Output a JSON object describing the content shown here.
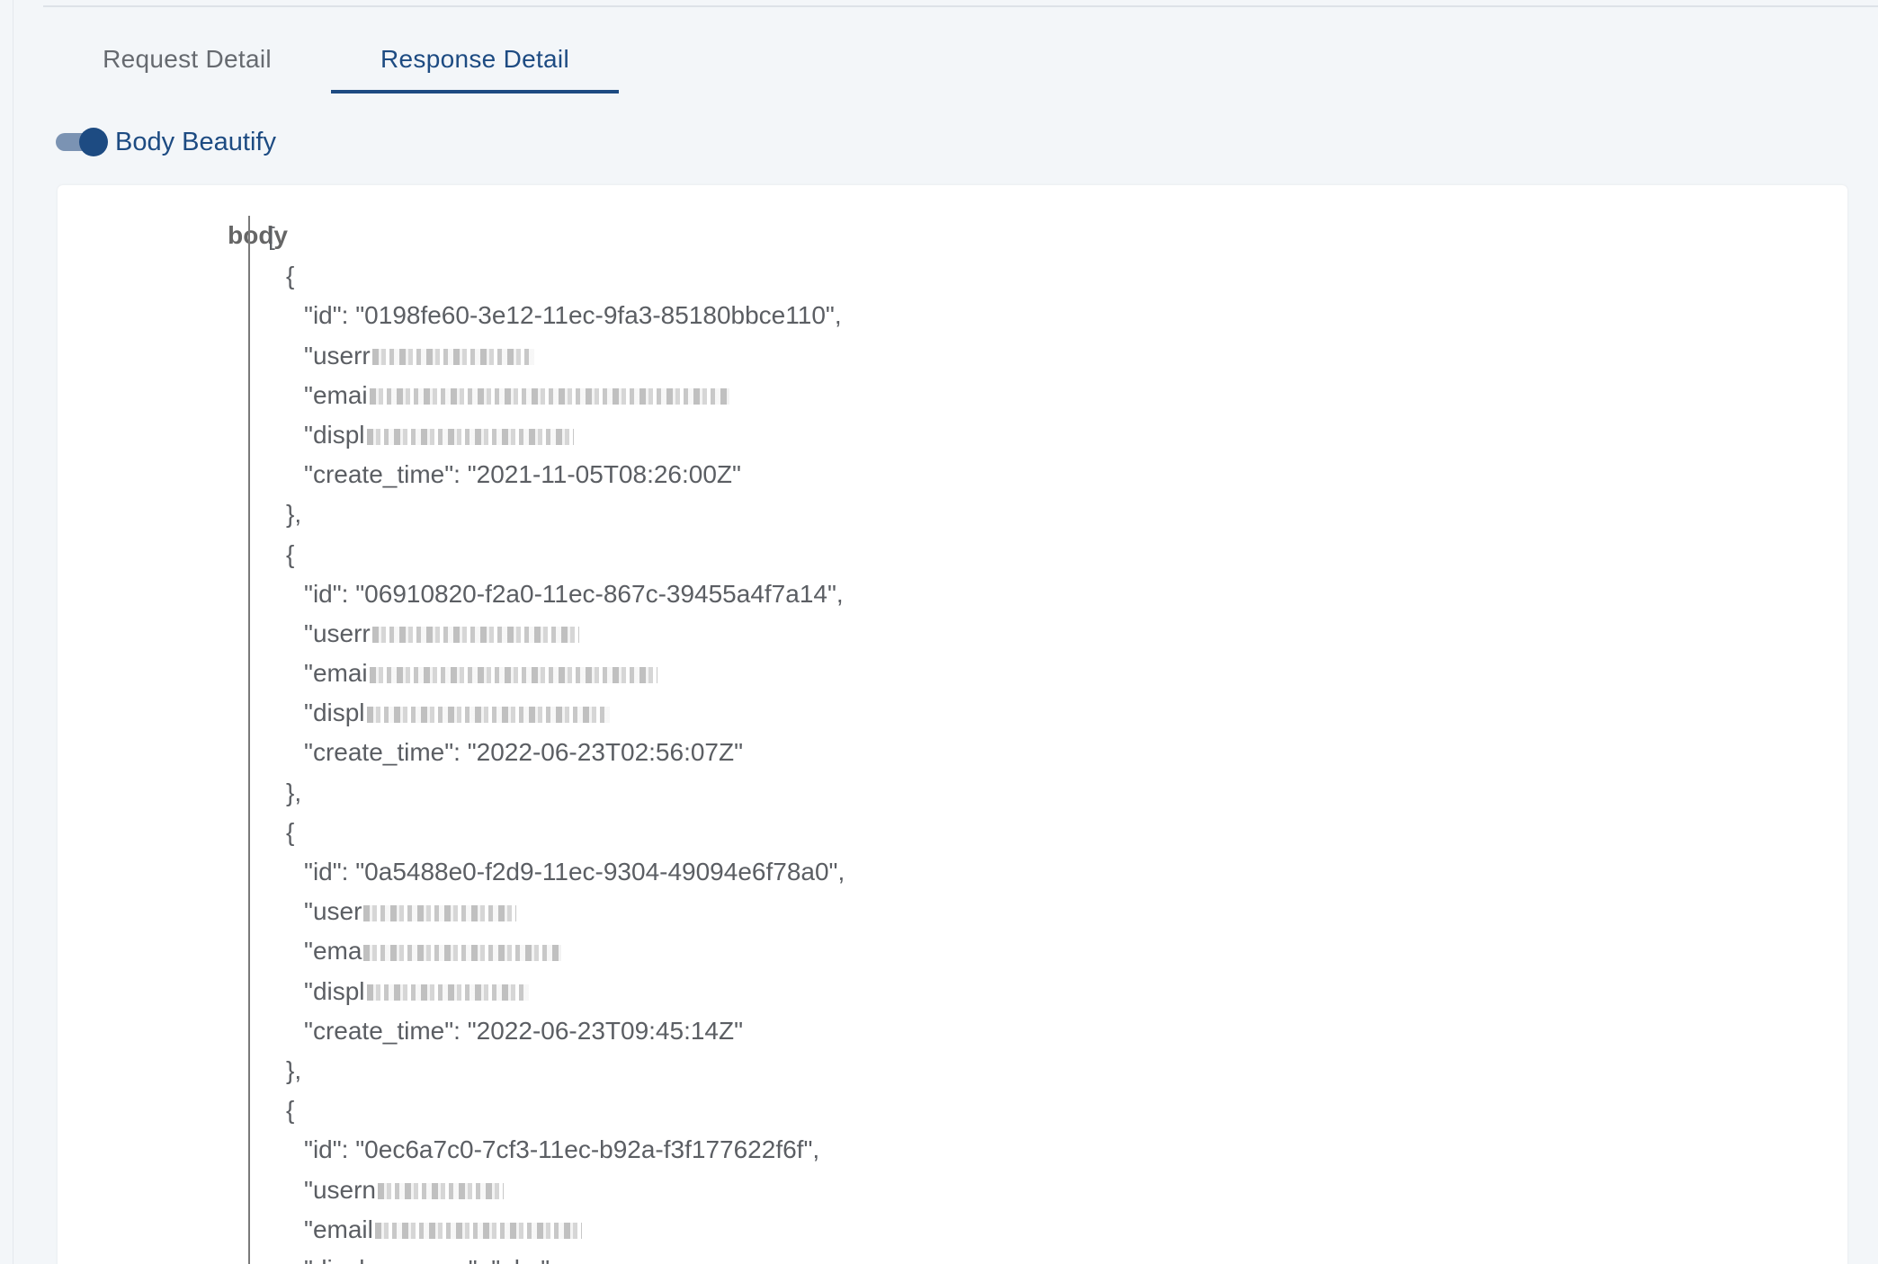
{
  "tabs": [
    {
      "label": "Request Detail",
      "active": false
    },
    {
      "label": "Response Detail",
      "active": true
    }
  ],
  "toggle": {
    "label": "Body Beautify",
    "on": true
  },
  "field": {
    "label": "body"
  },
  "body_lines": [
    {
      "text": "[",
      "indent": 0
    },
    {
      "text": "{",
      "indent": 1
    },
    {
      "text": "\"id\": \"0198fe60-3e12-11ec-9fa3-85180bbce110\",",
      "indent": 2
    },
    {
      "text": "\"userr",
      "indent": 2,
      "redacted": true
    },
    {
      "text": "\"emai",
      "indent": 2,
      "redacted": true
    },
    {
      "text": "\"displ",
      "indent": 2,
      "redacted": true
    },
    {
      "text": "\"create_time\": \"2021-11-05T08:26:00Z\"",
      "indent": 2
    },
    {
      "text": "},",
      "indent": 1
    },
    {
      "text": "{",
      "indent": 1
    },
    {
      "text": "\"id\": \"06910820-f2a0-11ec-867c-39455a4f7a14\",",
      "indent": 2
    },
    {
      "text": "\"userr",
      "indent": 2,
      "redacted": true
    },
    {
      "text": "\"emai",
      "indent": 2,
      "redacted": true
    },
    {
      "text": "\"displ",
      "indent": 2,
      "redacted": true
    },
    {
      "text": "\"create_time\": \"2022-06-23T02:56:07Z\"",
      "indent": 2
    },
    {
      "text": "},",
      "indent": 1
    },
    {
      "text": "{",
      "indent": 1
    },
    {
      "text": "\"id\": \"0a5488e0-f2d9-11ec-9304-49094e6f78a0\",",
      "indent": 2
    },
    {
      "text": "\"user",
      "indent": 2,
      "redacted": true
    },
    {
      "text": "\"ema",
      "indent": 2,
      "redacted": true
    },
    {
      "text": "\"displ",
      "indent": 2,
      "redacted": true
    },
    {
      "text": "\"create_time\": \"2022-06-23T09:45:14Z\"",
      "indent": 2
    },
    {
      "text": "},",
      "indent": 1
    },
    {
      "text": "{",
      "indent": 1
    },
    {
      "text": "\"id\": \"0ec6a7c0-7cf3-11ec-b92a-f3f177622f6f\",",
      "indent": 2
    },
    {
      "text": "\"usern",
      "indent": 2,
      "redacted": true
    },
    {
      "text": "\"email",
      "indent": 2,
      "redacted": true
    },
    {
      "text": "\"display_name\": \"abc\"",
      "indent": 2
    }
  ]
}
